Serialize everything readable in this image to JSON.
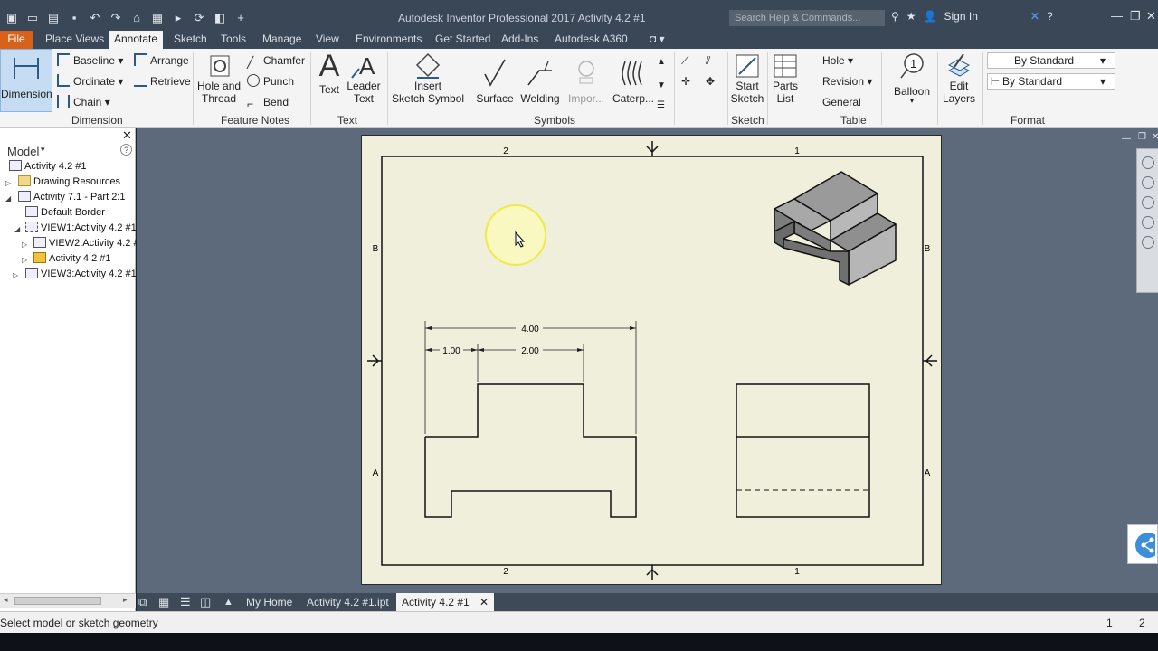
{
  "titlebar": {
    "app_title": "Autodesk Inventor Professional 2017    Activity 4.2 #1",
    "search_placeholder": "Search Help & Commands...",
    "sign_in": "Sign In"
  },
  "tabs": [
    "File",
    "Place Views",
    "Annotate",
    "Sketch",
    "Tools",
    "Manage",
    "View",
    "Environments",
    "Get Started",
    "Add-Ins",
    "Autodesk A360"
  ],
  "active_tab": "Annotate",
  "ribbon": {
    "dimension": {
      "big_button": "Dimension",
      "items": [
        "Baseline",
        "Ordinate",
        "Chain",
        "Arrange",
        "Retrieve"
      ],
      "label": "Dimension"
    },
    "feature_notes": {
      "hole_thread_line1": "Hole and",
      "hole_thread_line2": "Thread",
      "items": [
        "Chamfer",
        "Punch",
        "Bend"
      ],
      "label": "Feature Notes"
    },
    "text": {
      "text_btn": "Text",
      "leader_line1": "Leader",
      "leader_line2": "Text",
      "label": "Text"
    },
    "symbols": {
      "insert_line1": "Insert",
      "insert_line2": "Sketch Symbol",
      "surface": "Surface",
      "welding": "Welding",
      "import": "Impor...",
      "caterpillar": "Caterp...",
      "label": "Symbols"
    },
    "sketch": {
      "start_line1": "Start",
      "start_line2": "Sketch",
      "label": "Sketch"
    },
    "table": {
      "parts_line1": "Parts",
      "parts_line2": "List",
      "items": [
        "Hole",
        "Revision",
        "General"
      ],
      "label": "Table"
    },
    "balloon": "Balloon",
    "edit_layers_line1": "Edit",
    "edit_layers_line2": "Layers",
    "format": {
      "style1": "By Standard",
      "style2": "By Standard",
      "label": "Format"
    }
  },
  "browser": {
    "title": "Model",
    "items": [
      "Activity 4.2 #1",
      "Drawing Resources",
      "Activity 7.1 - Part 2:1",
      "Default Border",
      "VIEW1:Activity 4.2 #1",
      "VIEW2:Activity 4.2 #",
      "Activity 4.2 #1",
      "VIEW3:Activity 4.2 #1"
    ]
  },
  "sheet": {
    "zone_top_left": "2",
    "zone_top_right": "1",
    "zone_bottom_left": "2",
    "zone_bottom_right": "1",
    "zone_left_top": "B",
    "zone_left_bottom": "A",
    "zone_right_top": "B",
    "zone_right_bottom": "A",
    "dim_overall": "4.00",
    "dim_left": "1.00",
    "dim_middle": "2.00"
  },
  "doctabs": [
    "My Home",
    "Activity 4.2 #1.ipt",
    "Activity 4.2 #1"
  ],
  "active_doctab": "Activity 4.2 #1",
  "status": {
    "message": "Select model or sketch geometry",
    "count1": "1",
    "count2": "2"
  }
}
